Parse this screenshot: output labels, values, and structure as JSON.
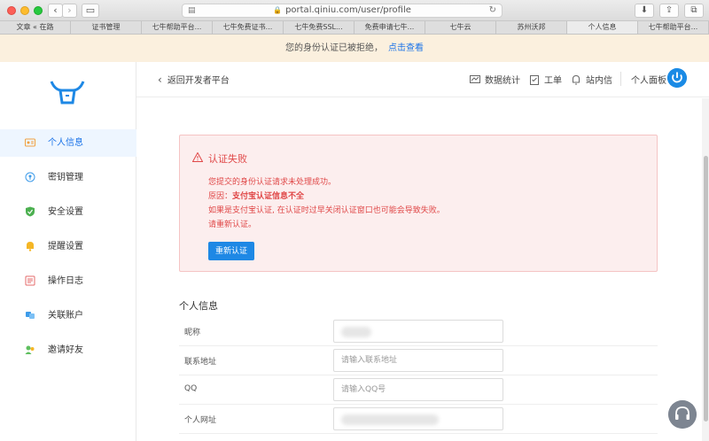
{
  "browser": {
    "url": "portal.qiniu.com/user/profile",
    "tabs": [
      {
        "label": "文章 « 在路"
      },
      {
        "label": "证书管理"
      },
      {
        "label": "七牛帮助平台..."
      },
      {
        "label": "七牛免费证书..."
      },
      {
        "label": "七牛免费SSL..."
      },
      {
        "label": "免费申请七牛..."
      },
      {
        "label": "七牛云"
      },
      {
        "label": "苏州沃邦"
      },
      {
        "label": "个人信息"
      },
      {
        "label": "七牛帮助平台..."
      }
    ]
  },
  "notice": {
    "text": "您的身份认证已被拒绝，",
    "link": "点击查看"
  },
  "sidebar": {
    "items": [
      {
        "label": "个人信息",
        "icon": "id-card-icon"
      },
      {
        "label": "密钥管理",
        "icon": "key-icon"
      },
      {
        "label": "安全设置",
        "icon": "shield-icon"
      },
      {
        "label": "提醒设置",
        "icon": "bell-icon"
      },
      {
        "label": "操作日志",
        "icon": "log-icon"
      },
      {
        "label": "关联账户",
        "icon": "link-account-icon"
      },
      {
        "label": "邀请好友",
        "icon": "invite-icon"
      }
    ]
  },
  "topbar": {
    "back": "返回开发者平台",
    "stats": "数据统计",
    "ticket": "工单",
    "inbox": "站内信",
    "panel": "个人面板"
  },
  "alert": {
    "title": "认证失败",
    "line1": "您提交的身份认证请求未处理成功。",
    "reason_prefix": "原因：",
    "reason": "支付宝认证信息不全",
    "line3": "如果是支付宝认证, 在认证时过早关闭认证窗口也可能会导致失败。",
    "line4": "请重新认证。",
    "button": "重新认证"
  },
  "profile": {
    "section": "个人信息",
    "fields": [
      {
        "label": "昵称",
        "value": "",
        "placeholder": ""
      },
      {
        "label": "联系地址",
        "value": "",
        "placeholder": "请输入联系地址"
      },
      {
        "label": "QQ",
        "value": "",
        "placeholder": "请输入QQ号"
      },
      {
        "label": "个人网址",
        "value": "",
        "placeholder": ""
      }
    ]
  },
  "colors": {
    "accent": "#1e88e5",
    "error": "#e04848",
    "alert_bg": "#fceeee",
    "notice_bg": "#fbf0de"
  }
}
